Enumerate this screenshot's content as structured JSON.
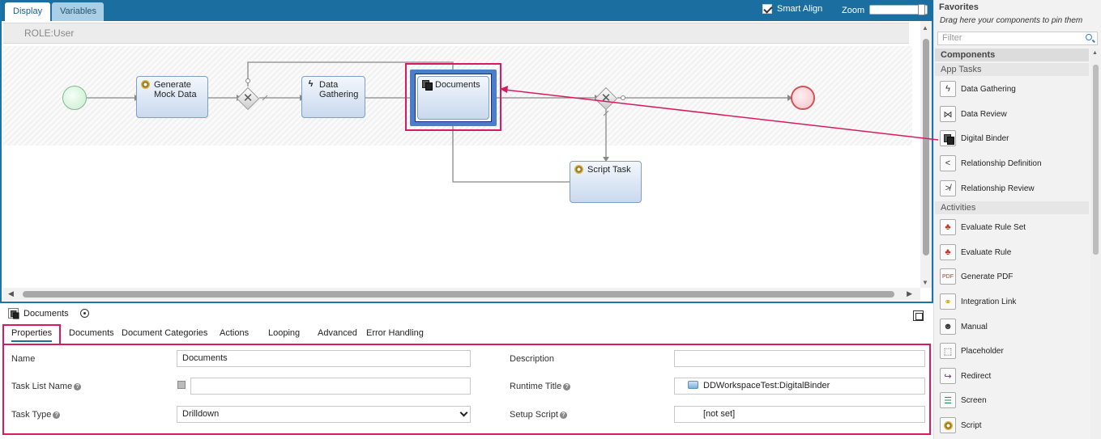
{
  "tabs": {
    "display": "Display",
    "variables": "Variables"
  },
  "toolbar": {
    "smart_align": "Smart Align",
    "zoom": "Zoom"
  },
  "lane": {
    "label": "ROLE:User"
  },
  "nodes": {
    "generate": "Generate Mock Data",
    "gathering": "Data Gathering",
    "documents": "Documents",
    "script": "Script Task"
  },
  "properties": {
    "title": "Documents",
    "tabs": [
      "Properties",
      "Documents",
      "Document Categories",
      "Actions",
      "Looping",
      "Advanced",
      "Error Handling"
    ],
    "fields": {
      "name_label": "Name",
      "name_value": "Documents",
      "description_label": "Description",
      "description_value": "",
      "task_list_name_label": "Task List Name",
      "task_list_name_value": "",
      "runtime_title_label": "Runtime Title",
      "runtime_title_value": "DDWorkspaceTest:DigitalBinder",
      "task_type_label": "Task Type",
      "task_type_value": "Drilldown",
      "setup_script_label": "Setup Script",
      "setup_script_value": "[not set]"
    }
  },
  "palette": {
    "favorites_title": "Favorites",
    "favorites_hint": "Drag here your components to pin them",
    "filter_placeholder": "Filter",
    "components_title": "Components",
    "groups": [
      {
        "name": "App Tasks",
        "items": [
          {
            "label": "Data Gathering",
            "icon": "bolt-icon"
          },
          {
            "label": "Data Review",
            "icon": "review-icon"
          },
          {
            "label": "Digital Binder",
            "icon": "documents-icon"
          },
          {
            "label": "Relationship Definition",
            "icon": "share-icon"
          },
          {
            "label": "Relationship Review",
            "icon": "share-review-icon"
          }
        ]
      },
      {
        "name": "Activities",
        "items": [
          {
            "label": "Evaluate Rule Set",
            "icon": "hierarchy-icon"
          },
          {
            "label": "Evaluate Rule",
            "icon": "hierarchy-icon"
          },
          {
            "label": "Generate PDF",
            "icon": "pdf-icon"
          },
          {
            "label": "Integration Link",
            "icon": "link-icon"
          },
          {
            "label": "Manual",
            "icon": "user-icon"
          },
          {
            "label": "Placeholder",
            "icon": "placeholder-icon"
          },
          {
            "label": "Redirect",
            "icon": "redirect-icon"
          },
          {
            "label": "Screen",
            "icon": "screen-icon"
          },
          {
            "label": "Script",
            "icon": "gear-icon"
          }
        ]
      }
    ]
  },
  "colors": {
    "header": "#1a6fa0",
    "highlight": "#d81b60",
    "selection": "#4a7ec9"
  }
}
